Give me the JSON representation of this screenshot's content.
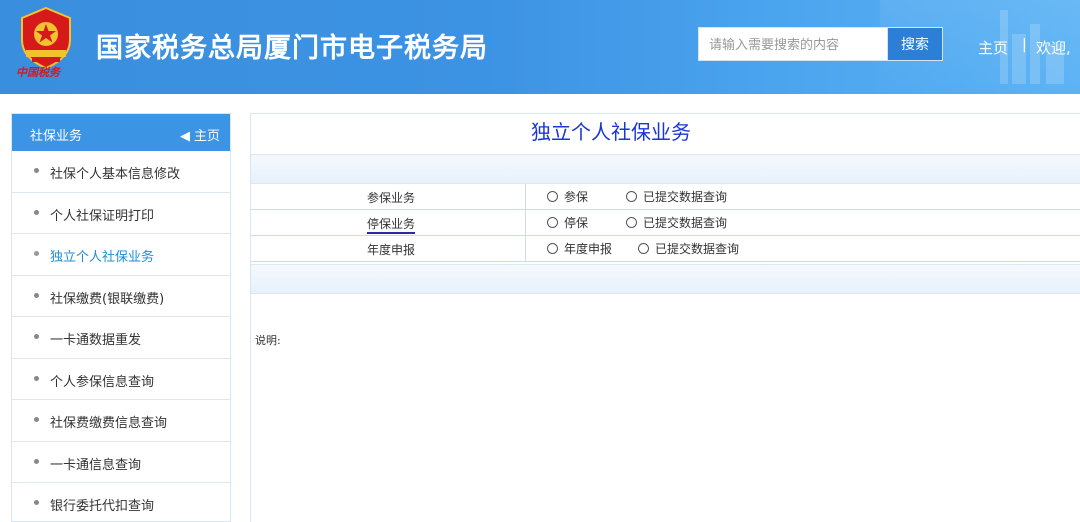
{
  "header": {
    "site_title": "国家税务总局厦门市电子税务局",
    "brand_script": "中国税务",
    "search_placeholder": "请输入需要搜索的内容",
    "search_button": "搜索",
    "nav_home": "主页",
    "nav_separator": "|",
    "nav_welcome": "欢迎,"
  },
  "sidebar": {
    "title": "社保业务",
    "home_link": "主页",
    "items": [
      {
        "label": "社保个人基本信息修改",
        "active": false
      },
      {
        "label": "个人社保证明打印",
        "active": false
      },
      {
        "label": "独立个人社保业务",
        "active": true
      },
      {
        "label": "社保缴费(银联缴费)",
        "active": false
      },
      {
        "label": "一卡通数据重发",
        "active": false
      },
      {
        "label": "个人参保信息查询",
        "active": false
      },
      {
        "label": "社保费缴费信息查询",
        "active": false
      },
      {
        "label": "一卡通信息查询",
        "active": false
      },
      {
        "label": "银行委托代扣查询",
        "active": false
      }
    ]
  },
  "main": {
    "page_title": "独立个人社保业务",
    "rows": [
      {
        "label": "参保业务",
        "options": [
          "参保",
          "已提交数据查询"
        ]
      },
      {
        "label": "停保业务",
        "options": [
          "停保",
          "已提交数据查询"
        ]
      },
      {
        "label": "年度申报",
        "options": [
          "年度申报",
          "已提交数据查询"
        ]
      }
    ],
    "note": "说明:"
  },
  "colors": {
    "header_blue": "#3d93e3",
    "sidebar_header": "#3c95e4",
    "active_item": "#1b8fd8",
    "title_blue": "#1a36d6"
  }
}
